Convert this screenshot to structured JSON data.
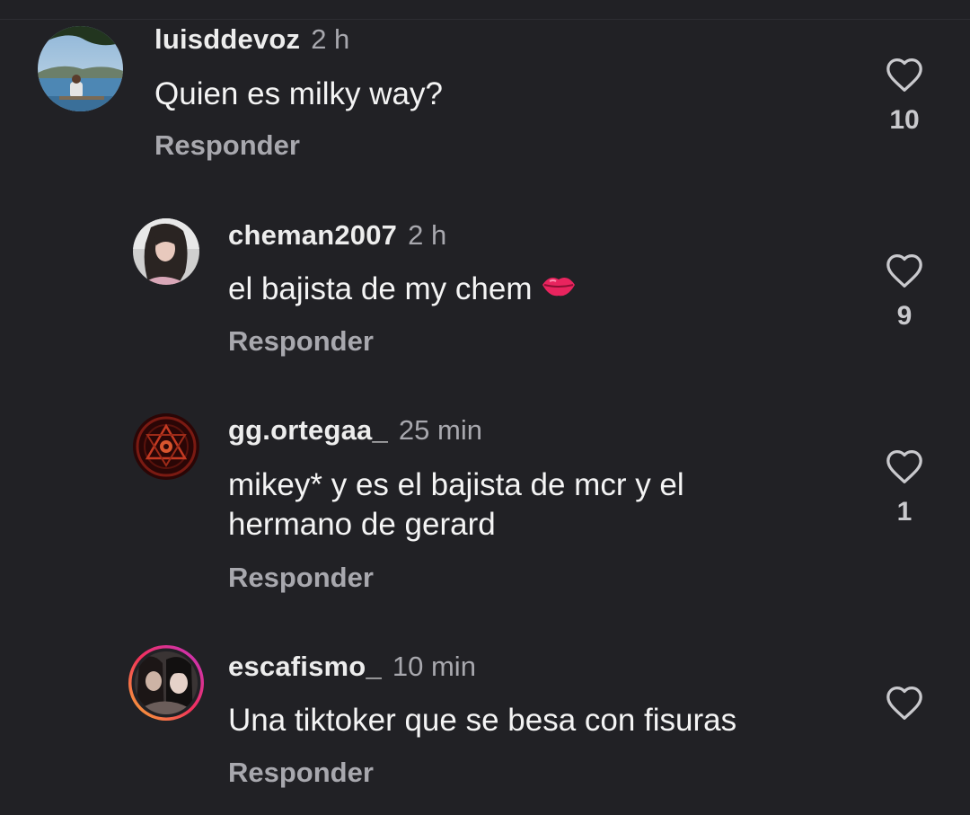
{
  "comments": [
    {
      "username": "luisddevoz",
      "time": "2 h",
      "text": "Quien es milky way?",
      "reply_label": "Responder",
      "likes": "10",
      "avatar": "photo-lakeside"
    },
    {
      "username": "cheman2007",
      "time": "2 h",
      "text": "el bajista de my chem",
      "emoji": "lips-emoji",
      "reply_label": "Responder",
      "likes": "9",
      "avatar": "photo-portrait"
    },
    {
      "username": "gg.ortegaa_",
      "time": "25 min",
      "text": "mikey* y es el bajista de mcr y el hermano de gerard",
      "reply_label": "Responder",
      "likes": "1",
      "avatar": "red-emblem"
    },
    {
      "username": "escafismo_",
      "time": "10 min",
      "text": "Una tiktoker que se besa con fisuras",
      "reply_label": "Responder",
      "likes": "",
      "avatar": "story-ring-photo"
    }
  ],
  "icons": {
    "like": "heart-outline-icon",
    "reaction": "lips-emoji"
  },
  "colors": {
    "background": "#212125",
    "username": "#ededed",
    "secondary_text": "#a8a8ae",
    "story_ring_start": "#f9b233",
    "story_ring_end": "#c233c8"
  }
}
